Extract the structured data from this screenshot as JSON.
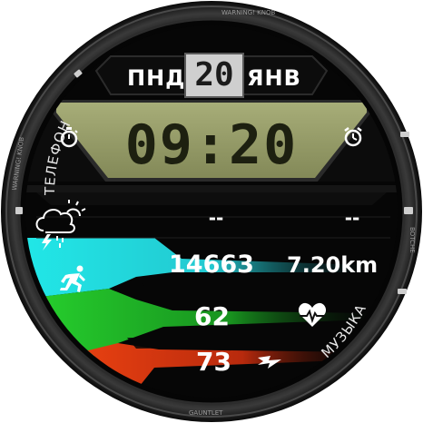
{
  "date": {
    "weekday": "ПНД",
    "day": "20",
    "month": "ЯНВ"
  },
  "time": "09:20",
  "arc_labels": {
    "phone": "ТЕЛЕФОН",
    "music": "МУЗЫКА"
  },
  "weather": {
    "value_left": "--",
    "value_right": "--",
    "icon": "cloud-rain-lightning-icon"
  },
  "activity": {
    "steps": "14663",
    "distance": "7.20km",
    "heart_rate": "62",
    "battery_or_energy": "73"
  },
  "colors": {
    "cyan": "#21e0e0",
    "green": "#22c52a",
    "red": "#e33a12",
    "lcd": "#9aa06a"
  }
}
